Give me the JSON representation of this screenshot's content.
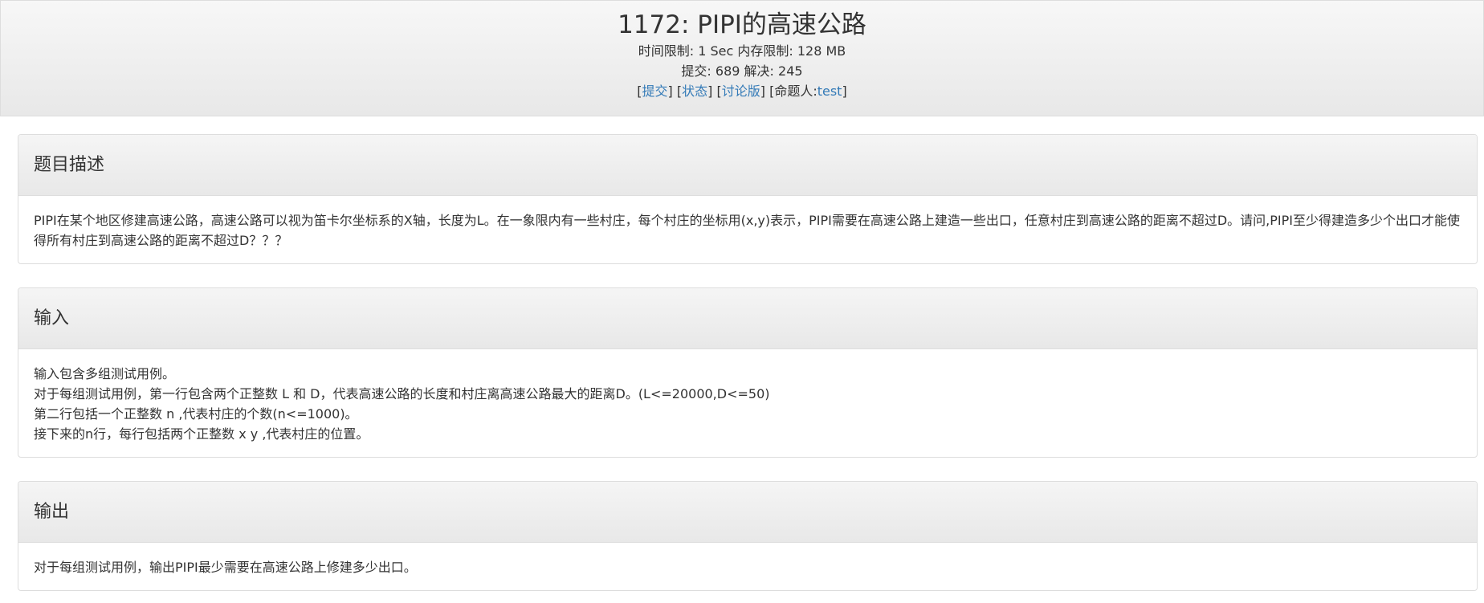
{
  "problem": {
    "title": "1172: PIPI的高速公路",
    "time_limit_label": "时间限制:",
    "time_limit_value": "1 Sec",
    "memory_limit_label": "内存限制:",
    "memory_limit_value": "128 MB",
    "submit_count_label": "提交:",
    "submit_count_value": "689",
    "solved_count_label": "解决:",
    "solved_count_value": "245",
    "links": {
      "submit": "提交",
      "status": "状态",
      "discuss": "讨论版",
      "setter_label": "命题人:",
      "setter": "test"
    }
  },
  "sections": {
    "description": {
      "heading": "题目描述",
      "lines": [
        "PIPI在某个地区修建高速公路，高速公路可以视为笛卡尔坐标系的X轴，长度为L。在一象限内有一些村庄，每个村庄的坐标用(x,y)表示，PIPI需要在高速公路上建造一些出口，任意村庄到高速公路的距离不超过D。请问,PIPI至少得建造多少个出口才能使得所有村庄到高速公路的距离不超过D？？？"
      ]
    },
    "input": {
      "heading": "输入",
      "lines": [
        "输入包含多组测试用例。",
        "对于每组测试用例，第一行包含两个正整数 L 和 D，代表高速公路的长度和村庄离高速公路最大的距离D。(L<=20000,D<=50)",
        "第二行包括一个正整数 n ,代表村庄的个数(n<=1000)。",
        "接下来的n行，每行包括两个正整数 x y ,代表村庄的位置。"
      ]
    },
    "output": {
      "heading": "输出",
      "lines": [
        "对于每组测试用例，输出PIPI最少需要在高速公路上修建多少出口。"
      ]
    }
  }
}
